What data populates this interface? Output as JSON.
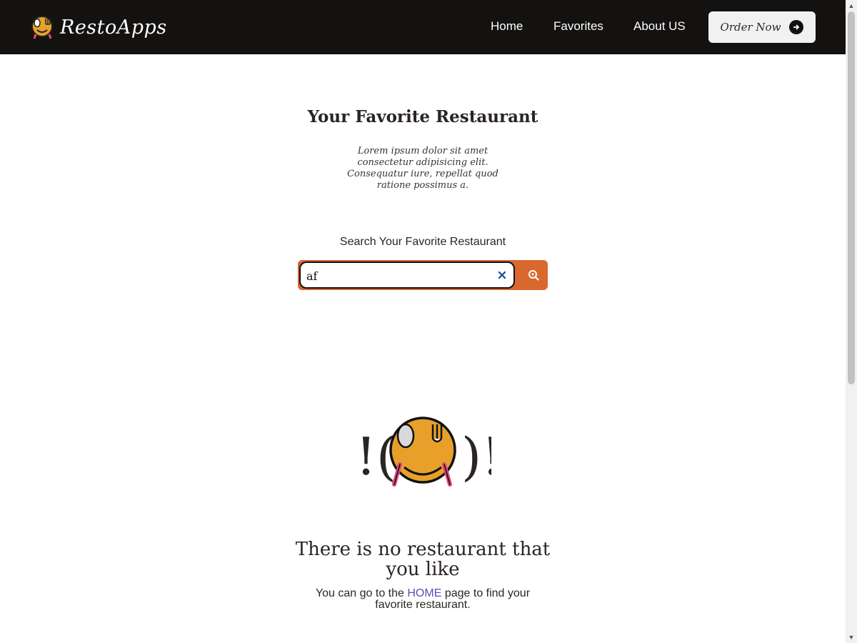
{
  "navbar": {
    "brand_name": "RestoApps",
    "links": [
      {
        "label": "Home"
      },
      {
        "label": "Favorites"
      },
      {
        "label": "About US"
      }
    ],
    "order_button": {
      "label": "Order Now",
      "icon": "arrow-right-icon"
    }
  },
  "hero": {
    "title": "Your Favorite Restaurant",
    "subtitle": "Lorem ipsum dolor sit amet consectetur adipisicing elit. Consequatur iure, repellat quod ratione possimus a."
  },
  "search": {
    "label": "Search Your Favorite Restaurant",
    "value": "af",
    "clear_icon": "close-icon",
    "button_icon": "search-icon"
  },
  "empty_state": {
    "illustration_text_left": "!(",
    "illustration_text_right": ")!",
    "title_line1": "There is no restaurant that",
    "title_line2": "you like",
    "text_before_link": "You can go to the",
    "link_label": "HOME",
    "text_after_link": "page to find your",
    "text_line2": "favorite restaurant."
  },
  "colors": {
    "navbar_bg": "#141211",
    "accent": "#d9682f",
    "logo_yellow": "#e8a02a",
    "link": "#5a4fb4"
  }
}
